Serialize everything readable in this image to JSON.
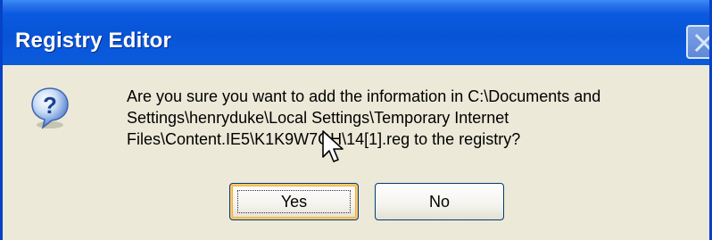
{
  "window": {
    "title": "Registry Editor"
  },
  "dialog": {
    "icon": "question-icon",
    "message_lines": [
      "Are you sure you want to add the information in C:\\Documents and",
      "Settings\\henryduke\\Local Settings\\Temporary Internet",
      "Files\\Content.IE5\\K1K9W7GH\\14[1].reg to the registry?"
    ],
    "buttons": {
      "yes_label": "Yes",
      "no_label": "No"
    }
  },
  "colors": {
    "titlebar": "#0854d6",
    "client_background": "#ece9d8",
    "default_button_highlight": "#f8c870"
  }
}
